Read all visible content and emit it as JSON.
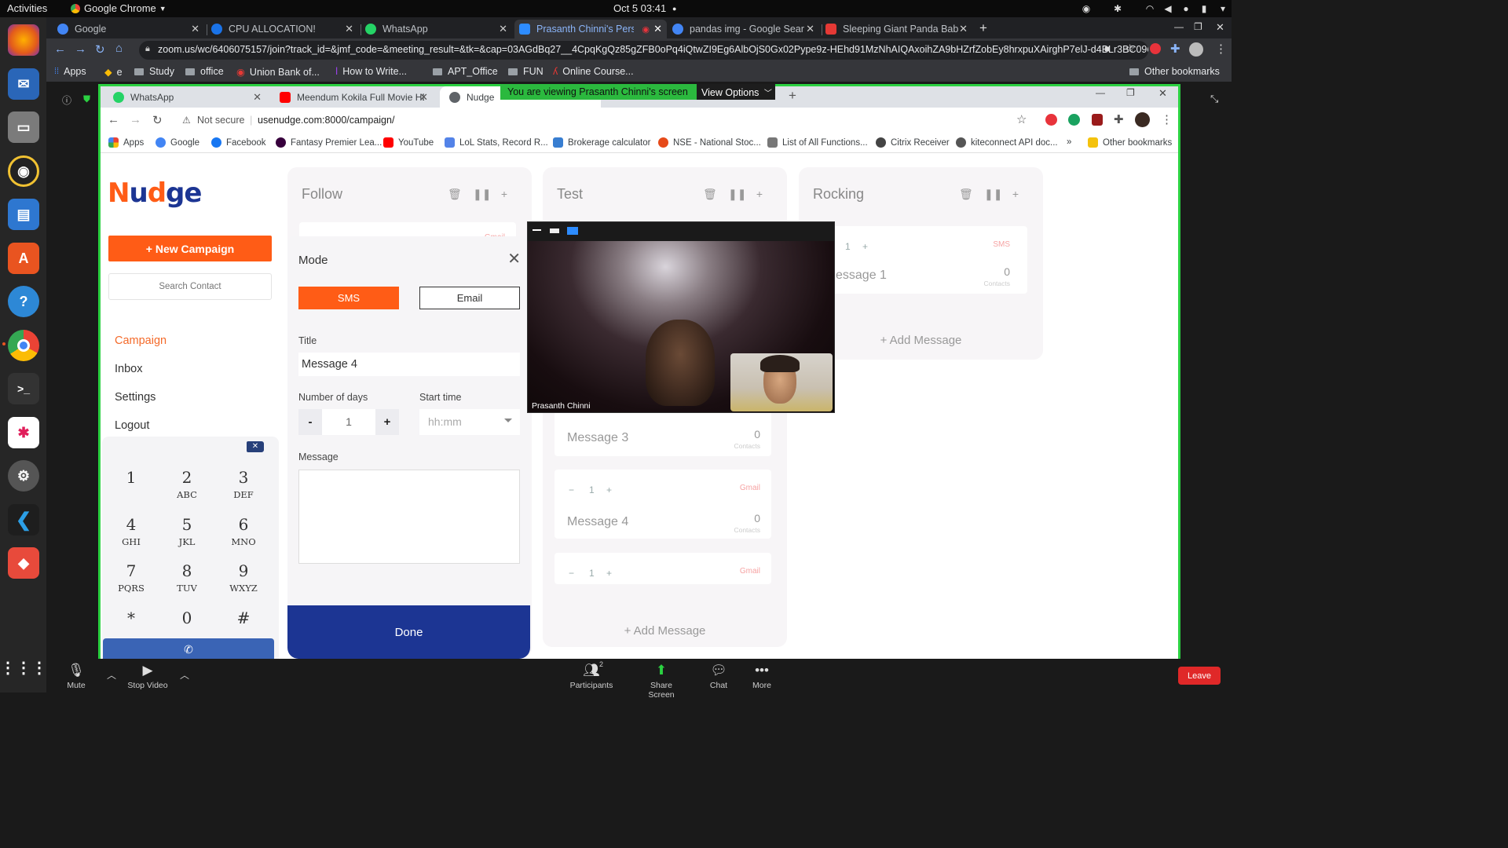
{
  "system": {
    "activities": "Activities",
    "app_menu": "Google Chrome",
    "clock": "Oct 5  03:41"
  },
  "outer_browser": {
    "tabs": [
      {
        "label": "Google",
        "color": "#4285f4"
      },
      {
        "label": "CPU ALLOCATION!",
        "color": "#1a73e8"
      },
      {
        "label": "WhatsApp",
        "color": "#25d366"
      },
      {
        "label": "Prasanth Chinni's Pers",
        "color": "#2d8cff"
      },
      {
        "label": "pandas img - Google Sear",
        "color": "#4285f4"
      },
      {
        "label": "Sleeping Giant Panda Bab",
        "color": "#e53935"
      }
    ],
    "url": "zoom.us/wc/6406075157/join?track_id=&jmf_code=&meeting_result=&tk=&cap=03AGdBq27__4CpqKgQz85gZFB0oPq4iQtwZI9Eg6AlbOjS0Gx02Pype9z-HEhd91MzNhAIQAxoihZA9bHZrfZobEy8hrxpuXAirghP7elJ-d4BLr3BC090DI...",
    "bookmarks": [
      "Apps",
      "e",
      "Study",
      "office",
      "Union Bank of...",
      "How to Write...",
      "APT_Office",
      "FUN",
      "Online Course...",
      "Other bookmarks"
    ]
  },
  "zoom": {
    "viewing_banner": "You are viewing Prasanth Chinni's screen",
    "view_options": "View Options",
    "video_name": "Prasanth Chinni",
    "toolbar": {
      "mute": "Mute",
      "stop_video": "Stop Video",
      "participants": "Participants",
      "participants_count": "2",
      "share_screen": "Share Screen",
      "chat": "Chat",
      "more": "More",
      "leave": "Leave"
    }
  },
  "inner_browser": {
    "tabs": [
      {
        "label": "WhatsApp",
        "color": "#25d366"
      },
      {
        "label": "Meendum Kokila Full Movie HD",
        "color": "#ff0000"
      },
      {
        "label": "Nudge",
        "color": "#5f6368"
      }
    ],
    "not_secure": "Not secure",
    "url": "usenudge.com:8000/campaign/",
    "bookmarks": [
      {
        "label": "Apps",
        "color": "#ea4335"
      },
      {
        "label": "Google",
        "color": "#4285f4"
      },
      {
        "label": "Facebook",
        "color": "#1877f2"
      },
      {
        "label": "Fantasy Premier Lea...",
        "color": "#37003c"
      },
      {
        "label": "YouTube",
        "color": "#ff0000"
      },
      {
        "label": "LoL Stats, Record R...",
        "color": "#5383e8"
      },
      {
        "label": "Brokerage calculator",
        "color": "#387ed1"
      },
      {
        "label": "NSE - National Stoc...",
        "color": "#e64a19"
      },
      {
        "label": "List of All Functions...",
        "color": "#777777"
      },
      {
        "label": "Citrix Receiver",
        "color": "#444444"
      },
      {
        "label": "kiteconnect API doc...",
        "color": "#555555"
      },
      {
        "label": "Other bookmarks",
        "color": "#f4c20d"
      }
    ]
  },
  "app": {
    "brand_color": "#ff5c16",
    "new_campaign": "+ New Campaign",
    "search_contact": "Search Contact",
    "nav": [
      "Campaign",
      "Inbox",
      "Settings",
      "Logout"
    ],
    "dialpad": [
      {
        "num": "1",
        "sub": ""
      },
      {
        "num": "2",
        "sub": "ABC"
      },
      {
        "num": "3",
        "sub": "DEF"
      },
      {
        "num": "4",
        "sub": "GHI"
      },
      {
        "num": "5",
        "sub": "JKL"
      },
      {
        "num": "6",
        "sub": "MNO"
      },
      {
        "num": "7",
        "sub": "PQRS"
      },
      {
        "num": "8",
        "sub": "TUV"
      },
      {
        "num": "9",
        "sub": "WXYZ"
      },
      {
        "num": "*",
        "sub": ""
      },
      {
        "num": "0",
        "sub": ""
      },
      {
        "num": "#",
        "sub": ""
      }
    ],
    "columns": [
      {
        "title": "Follow"
      },
      {
        "title": "Test",
        "cards": [
          {
            "title": "Message 3",
            "count": "0",
            "contacts": "Contacts"
          },
          {
            "step_value": "1",
            "badge": "Gmail",
            "title": "Message 4",
            "count": "0",
            "contacts": "Contacts"
          },
          {
            "step_value": "1",
            "badge": "Gmail"
          }
        ],
        "add_message": "+ Add Message"
      },
      {
        "title": "Rocking",
        "cards": [
          {
            "step_value": "1",
            "badge": "SMS",
            "title": "essage 1",
            "count": "0",
            "contacts": "Contacts"
          }
        ],
        "add_message": "+ Add Message"
      }
    ],
    "follow_card_badge": "Gmail",
    "mode_panel": {
      "title": "Mode",
      "sms": "SMS",
      "email": "Email",
      "title_label": "Title",
      "title_value": "Message 4",
      "days_label": "Number of days",
      "days_value": "1",
      "start_label": "Start time",
      "start_placeholder": "hh:mm",
      "message_label": "Message",
      "done": "Done"
    }
  }
}
